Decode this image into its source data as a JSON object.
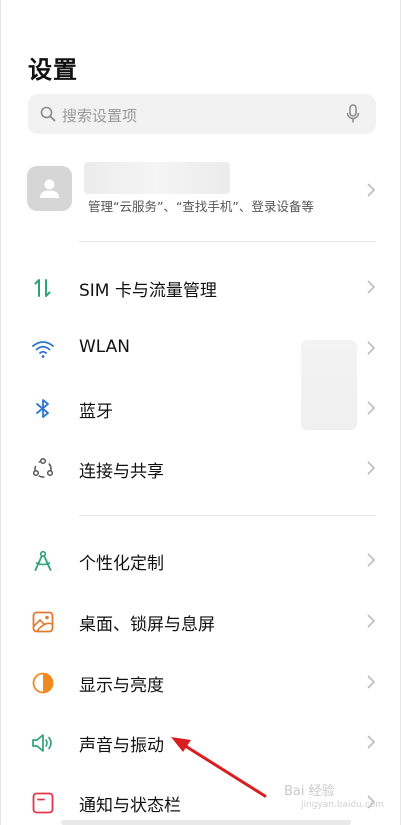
{
  "header": {
    "title": "设置"
  },
  "search": {
    "placeholder": "搜索设置项",
    "icon": "search-icon",
    "voice_icon": "microphone-icon"
  },
  "account": {
    "subtitle": "管理“云服务”、“查找手机”、登录设备等",
    "avatar_icon": "person-icon"
  },
  "groups": [
    [
      {
        "label": "SIM 卡与流量管理",
        "icon": "sim-data-icon",
        "color": "#2ea27a"
      },
      {
        "label": "WLAN",
        "icon": "wifi-icon",
        "color": "#2f74d0"
      },
      {
        "label": "蓝牙",
        "icon": "bluetooth-icon",
        "color": "#2f74d0"
      },
      {
        "label": "连接与共享",
        "icon": "share-icon",
        "color": "#555555"
      }
    ],
    [
      {
        "label": "个性化定制",
        "icon": "compass-icon",
        "color": "#2ea27a"
      },
      {
        "label": "桌面、锁屏与息屏",
        "icon": "wallpaper-icon",
        "color": "#e07a2e"
      },
      {
        "label": "显示与亮度",
        "icon": "brightness-icon",
        "color": "#f08a1f"
      },
      {
        "label": "声音与振动",
        "icon": "sound-icon",
        "color": "#2ea27a"
      },
      {
        "label": "通知与状态栏",
        "icon": "notification-icon",
        "color": "#e2374a"
      }
    ]
  ],
  "annotation": {
    "arrow_color": "#d81e1e"
  },
  "watermark": {
    "text": "Bai 经验",
    "sub": "jingyan.baidu.com"
  }
}
